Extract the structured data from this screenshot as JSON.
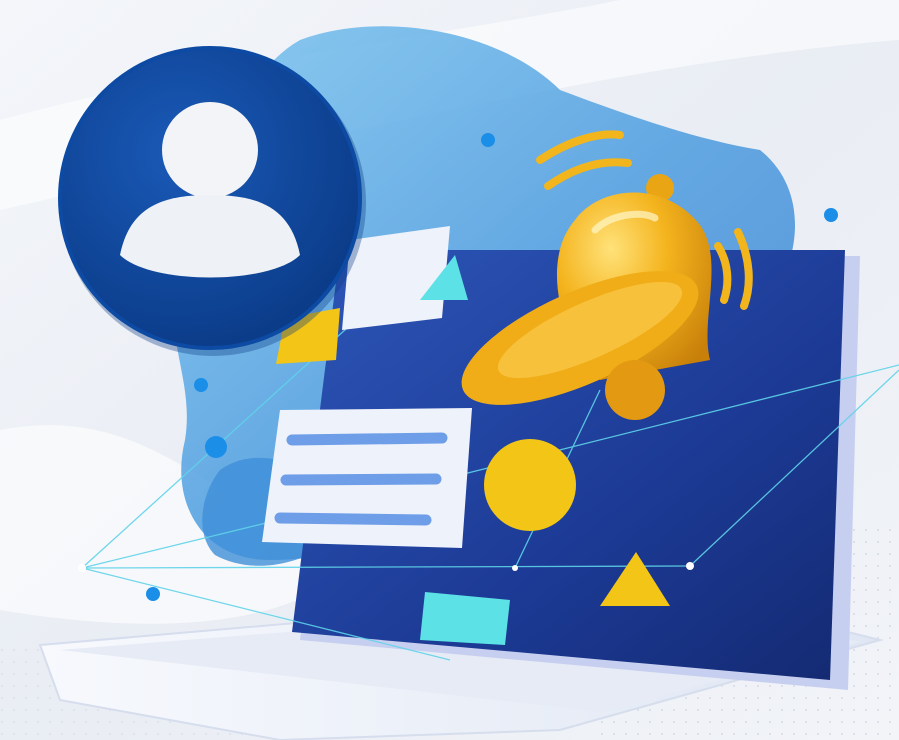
{
  "illustration": {
    "icons": [
      "user-avatar-icon",
      "notification-bell-icon"
    ],
    "colors": {
      "background": "#eef1f7",
      "blob_light": "#63b3e8",
      "blob_mid": "#3e8fd6",
      "avatar_circle": "#0a3f8f",
      "avatar_figure": "#f2f4f7",
      "screen_panel": "#1d3c96",
      "bell_gold": "#f2b51c",
      "yellow_accent": "#f2c516",
      "cyan_accent": "#5ce1e6",
      "card_white": "#eef2fb",
      "card_line": "#6f9ee8",
      "network_line": "#5fd3e9"
    }
  }
}
